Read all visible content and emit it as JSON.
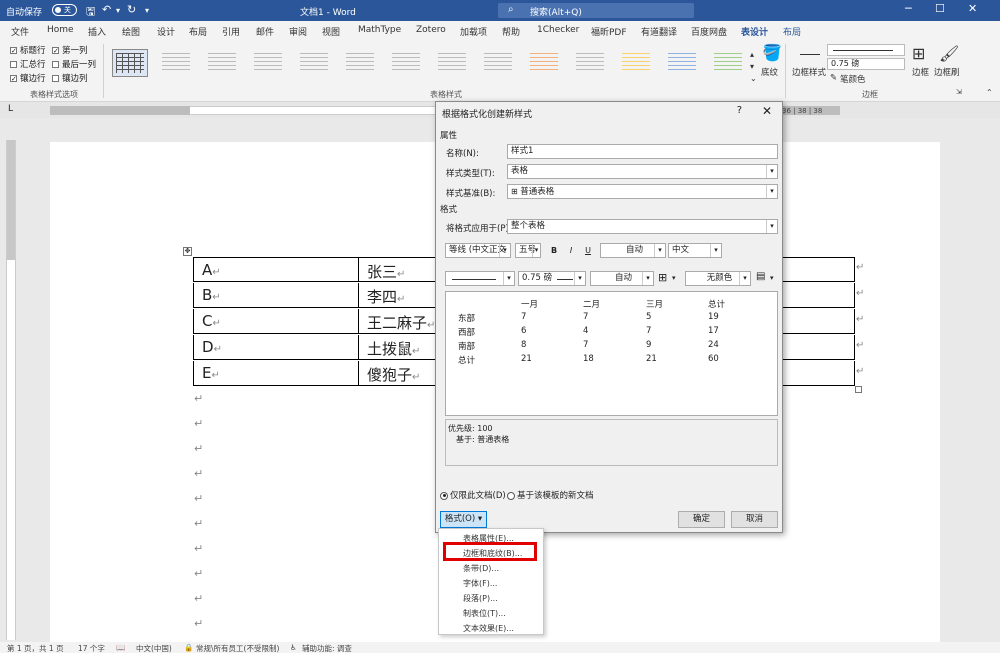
{
  "titlebar": {
    "autosave_label": "自动保存",
    "autosave_state": "关",
    "doc_title": "文档1 - Word",
    "search_placeholder": "搜索(Alt+Q)",
    "colors": {
      "bar": "#2b579a",
      "search": "#4a72b0"
    }
  },
  "menu": {
    "tabs": [
      "文件",
      "Home",
      "插入",
      "绘图",
      "设计",
      "布局",
      "引用",
      "邮件",
      "审阅",
      "视图",
      "MathType",
      "Zotero",
      "加载项",
      "帮助",
      "1Checker",
      "福昕PDF",
      "有道翻译",
      "百度网盘",
      "表设计",
      "布局"
    ],
    "active_tab": "表设计"
  },
  "ribbon": {
    "options": {
      "header_row": "标题行",
      "first_column": "第一列",
      "total_row": "汇总行",
      "last_column": "最后一列",
      "banded_rows": "镶边行",
      "banded_columns": "镶边列"
    },
    "group_options_label": "表格样式选项",
    "group_styles_label": "表格样式",
    "shading_label": "底纹",
    "border_styles_label": "边框样式",
    "pen_weight": "0.75 磅",
    "pen_color_label": "笔颜色",
    "borders_label": "边框",
    "border_painter_label": "边框刷",
    "group_borders_label": "边框"
  },
  "ruler": {
    "right_numbers": "36 | 38 | 38"
  },
  "document": {
    "rows": [
      {
        "a": "A",
        "b": "张三"
      },
      {
        "a": "B",
        "b": "李四"
      },
      {
        "a": "C",
        "b": "王二麻子"
      },
      {
        "a": "D",
        "b": "土拨鼠"
      },
      {
        "a": "E",
        "b": "傻狍子"
      }
    ],
    "para_mark": "↵"
  },
  "dialog": {
    "title": "根据格式化创建新样式",
    "help": "?",
    "close": "✕",
    "section_properties": "属性",
    "name_label": "名称(N):",
    "name_value": "样式1",
    "type_label": "样式类型(T):",
    "type_value": "表格",
    "base_label": "样式基准(B):",
    "base_value": "普通表格",
    "section_format": "格式",
    "apply_label": "将格式应用于(P):",
    "apply_value": "整个表格",
    "font_value": "等线 (中文正文",
    "size_value": "五号",
    "bold": "B",
    "italic": "I",
    "underline": "U",
    "font_color": "自动",
    "script": "中文",
    "border_weight": "0.75 磅",
    "border_color": "自动",
    "shading_color": "无颜色",
    "preview": {
      "headers": [
        "一月",
        "二月",
        "三月",
        "总计"
      ],
      "rows": [
        {
          "label": "东部",
          "values": [
            "7",
            "7",
            "5",
            "19"
          ]
        },
        {
          "label": "西部",
          "values": [
            "6",
            "4",
            "7",
            "17"
          ]
        },
        {
          "label": "南部",
          "values": [
            "8",
            "7",
            "9",
            "24"
          ]
        },
        {
          "label": "总计",
          "values": [
            "21",
            "18",
            "21",
            "60"
          ]
        }
      ]
    },
    "desc_priority": "优先级: 100",
    "desc_based": "基于: 普通表格",
    "radio_this_doc": "仅限此文档(D)",
    "radio_template": "基于该模板的新文档",
    "format_button": "格式(O) ▾",
    "ok": "确定",
    "cancel": "取消"
  },
  "context_menu": {
    "items": [
      "表格属性(E)...",
      "边框和底纹(B)...",
      "条带(D)...",
      "字体(F)...",
      "段落(P)...",
      "制表位(T)...",
      "文本效果(E)..."
    ],
    "highlight_color": "#e00000"
  },
  "statusbar": {
    "page": "第 1 页，共 1 页",
    "words": "17 个字",
    "language": "中文(中国)",
    "sensitivity": "常规\\所有员工(不受限制)",
    "accessibility": "辅助功能: 调查"
  }
}
